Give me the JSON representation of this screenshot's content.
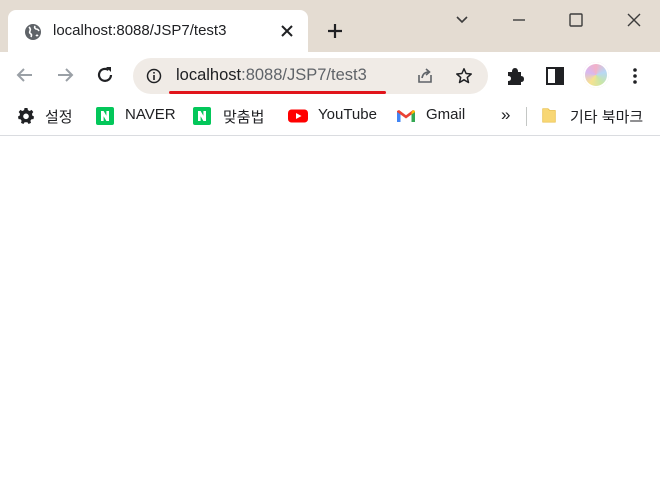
{
  "tab": {
    "title": "localhost:8088/JSP7/test3",
    "favicon": "globe-icon",
    "close": "close-icon"
  },
  "newtab": {
    "icon": "plus-icon"
  },
  "window_controls": {
    "icons": [
      "chevron-down-icon",
      "minimize-icon",
      "maximize-icon",
      "close-icon"
    ]
  },
  "navigation": {
    "back": "back-arrow-icon",
    "forward": "forward-arrow-icon",
    "reload": "reload-icon"
  },
  "omnibox": {
    "host": "localhost",
    "rest": ":8088/JSP7/test3",
    "info_icon": "info-icon",
    "share_icon": "share-icon",
    "star_icon": "star-icon",
    "underline_color": "#e1141b"
  },
  "toolbar_icons": {
    "extensions": "puzzle-icon",
    "side_panel": "side-panel-icon",
    "profile": "avatar",
    "menu": "kebab-menu-icon"
  },
  "bookmarks": {
    "items": [
      {
        "label": "설정",
        "icon": "gear-icon"
      },
      {
        "label": "NAVER",
        "icon": "naver-icon"
      },
      {
        "label": "맞춤법",
        "icon": "naver-icon"
      },
      {
        "label": "YouTube",
        "icon": "youtube-icon"
      },
      {
        "label": "Gmail",
        "icon": "gmail-icon"
      }
    ],
    "overflow": "»",
    "other": {
      "label": "기타 북마크",
      "icon": "folder-icon"
    }
  },
  "colors": {
    "titlebar": "#e4dcd2",
    "omnibox": "#f0ebe6",
    "naver_green": "#03c75a",
    "youtube_red": "#ff0000"
  }
}
